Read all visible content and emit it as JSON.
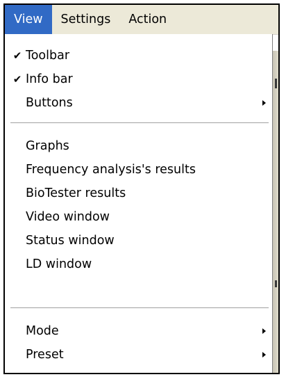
{
  "menubar": {
    "items": [
      {
        "label": "View",
        "active": true
      },
      {
        "label": "Settings"
      },
      {
        "label": "Action"
      }
    ]
  },
  "view_menu": {
    "items": [
      {
        "label": "Toolbar",
        "checked": true
      },
      {
        "label": "Info bar",
        "checked": true
      },
      {
        "label": "Buttons",
        "submenu": true
      },
      {
        "label": "Graphs"
      },
      {
        "label": "Frequency analysis's results"
      },
      {
        "label": "BioTester results"
      },
      {
        "label": "Video window"
      },
      {
        "label": "Status window"
      },
      {
        "label": "LD window"
      },
      {
        "label": "Mode",
        "submenu": true
      },
      {
        "label": "Preset",
        "submenu": true
      }
    ],
    "check_glyph": "✔"
  },
  "colors": {
    "menubar_bg": "#ece9d8",
    "highlight": "#316ac5",
    "menu_bg": "#ffffff"
  }
}
